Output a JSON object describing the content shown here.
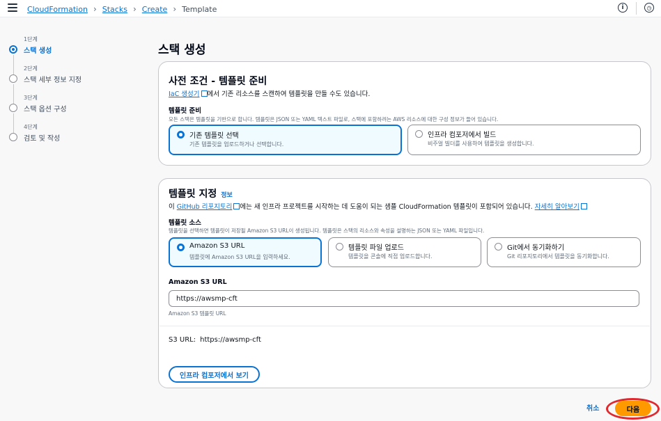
{
  "breadcrumb": {
    "items": [
      "CloudFormation",
      "Stacks",
      "Create"
    ],
    "current": "Template",
    "separator": "›"
  },
  "topbar": {
    "info_icon": "info-icon",
    "settings_icon": "settings-clock-icon"
  },
  "steps": [
    {
      "num": "1단계",
      "label": "스택 생성",
      "active": true
    },
    {
      "num": "2단계",
      "label": "스택 세부 정보 지정",
      "active": false
    },
    {
      "num": "3단계",
      "label": "스택 옵션 구성",
      "active": false
    },
    {
      "num": "4단계",
      "label": "검토 및 작성",
      "active": false
    }
  ],
  "page_title": "스택 생성",
  "prereq": {
    "title": "사전 조건 - 템플릿 준비",
    "desc_link": "IaC 생성기",
    "desc_rest": "에서 기존 리소스를 스캔하여 템플릿을 만들 수도 있습니다.",
    "field_label": "템플릿 준비",
    "field_desc": "모든 스택은 템플릿을 기반으로 합니다. 템플릿은 JSON 또는 YAML 텍스트 파일로, 스택에 포함하려는 AWS 리소스에 대한 구성 정보가 들어 있습니다.",
    "options": [
      {
        "title": "기존 템플릿 선택",
        "desc": "기존 템플릿을 업로드하거나 선택합니다."
      },
      {
        "title": "인프라 컴포저에서 빌드",
        "desc": "비주얼 빌더를 사용하여 템플릿을 생성합니다."
      }
    ],
    "selected_index": 0
  },
  "specify": {
    "title": "템플릿 지정",
    "info": "정보",
    "desc_prefix": "이 ",
    "desc_link": "GitHub 리포지토리",
    "desc_middle": "에는 새 인프라 프로젝트를 시작하는 데 도움이 되는 샘플 CloudFormation 템플릿이 포함되어 있습니다.",
    "desc_more": "자세히 알아보기",
    "source_label": "템플릿 소스",
    "source_desc": "템플릿을 선택하면 템플릿이 저장될 Amazon S3 URL이 생성됩니다. 템플릿은 스택의 리소스와 속성을 설명하는 JSON 또는 YAML 파일입니다.",
    "sources": [
      {
        "title": "Amazon S3 URL",
        "desc": "템플릿에 Amazon S3 URL을 입력하세요."
      },
      {
        "title": "템플릿 파일 업로드",
        "desc": "템플릿을 콘솔에 직접 업로드합니다."
      },
      {
        "title": "Git에서 동기화하기",
        "desc": "Git 리포지토리에서 템플릿을 동기화합니다."
      }
    ],
    "selected_index": 0,
    "url_label": "Amazon S3 URL",
    "url_value": "https://awsmp-cft",
    "url_hint": "Amazon S3 템플릿 URL",
    "s3_label": "S3 URL:",
    "s3_value": "https://awsmp-cft",
    "composer_button": "인프라 컴포저에서 보기"
  },
  "footer": {
    "cancel": "취소",
    "next": "다음"
  },
  "colors": {
    "accent": "#0972d3",
    "primary_button": "#ff9900",
    "highlight_ring": "#e0292f"
  }
}
